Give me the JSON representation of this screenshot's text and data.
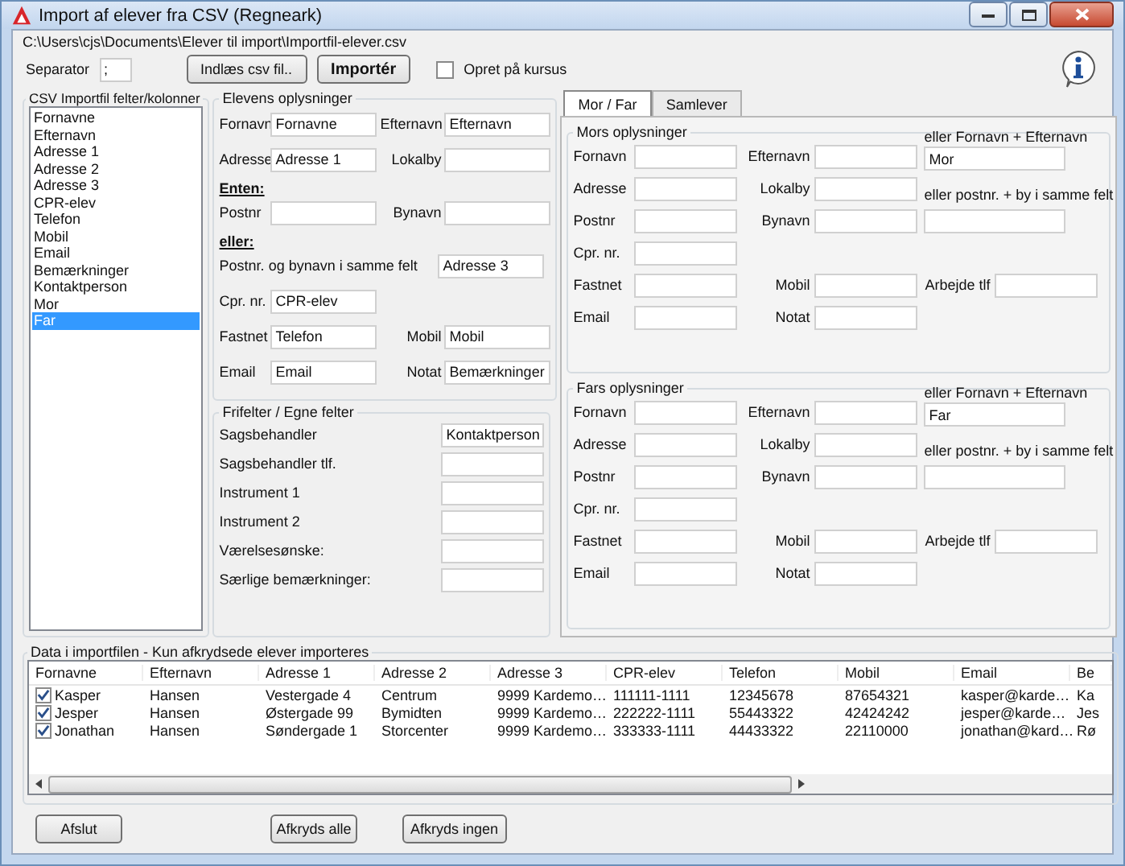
{
  "window": {
    "title": "Import af elever fra CSV (Regneark)"
  },
  "file_path": "C:\\Users\\cjs\\Documents\\Elever til import\\Importfil-elever.csv",
  "toolbar": {
    "separator_label": "Separator",
    "separator_value": ";",
    "load_button": "Indlæs csv fil..",
    "import_button": "Importér",
    "create_on_course": {
      "label": "Opret på kursus",
      "checked": false
    }
  },
  "csv_columns": {
    "title": "CSV Importfil felter/kolonner",
    "items": [
      {
        "label": "Fornavne",
        "selected": false
      },
      {
        "label": "Efternavn",
        "selected": false
      },
      {
        "label": "Adresse 1",
        "selected": false
      },
      {
        "label": "Adresse 2",
        "selected": false
      },
      {
        "label": "Adresse 3",
        "selected": false
      },
      {
        "label": "CPR-elev",
        "selected": false
      },
      {
        "label": "Telefon",
        "selected": false
      },
      {
        "label": "Mobil",
        "selected": false
      },
      {
        "label": "Email",
        "selected": false
      },
      {
        "label": "Bemærkninger",
        "selected": false
      },
      {
        "label": "Kontaktperson",
        "selected": false
      },
      {
        "label": "Mor",
        "selected": false
      },
      {
        "label": "Far",
        "selected": true
      }
    ]
  },
  "student_info": {
    "title": "Elevens oplysninger",
    "rows": [
      {
        "kind": "pair",
        "cells": [
          {
            "label": "Fornavn",
            "value": "Fornavne"
          },
          {
            "label": "Efternavn",
            "value": "Efternavn"
          }
        ]
      },
      {
        "kind": "pair",
        "cells": [
          {
            "label": "Adresse",
            "value": "Adresse 1"
          },
          {
            "label": "Lokalby"
          }
        ]
      },
      {
        "kind": "heading",
        "text": "Enten:"
      },
      {
        "kind": "pair",
        "cells": [
          {
            "label": "Postnr"
          },
          {
            "label": "Bynavn"
          }
        ]
      },
      {
        "kind": "heading",
        "text": "eller:"
      },
      {
        "kind": "wide",
        "label": "Postnr. og bynavn i samme felt",
        "value": "Adresse 3"
      },
      {
        "kind": "pair",
        "cells": [
          {
            "label": "Cpr. nr.",
            "value": "CPR-elev"
          }
        ]
      },
      {
        "kind": "pair",
        "cells": [
          {
            "label": "Fastnet",
            "value": "Telefon"
          },
          {
            "label": "Mobil",
            "value": "Mobil"
          }
        ]
      },
      {
        "kind": "pair",
        "cells": [
          {
            "label": "Email",
            "value": "Email"
          },
          {
            "label": "Notat",
            "value": "Bemærkninger"
          }
        ]
      }
    ]
  },
  "free_fields": {
    "title": "Frifelter / Egne felter",
    "fields": [
      {
        "label": "Sagsbehandler",
        "value": "Kontaktperson"
      },
      {
        "label": "Sagsbehandler tlf."
      },
      {
        "label": "Instrument 1"
      },
      {
        "label": "Instrument 2"
      },
      {
        "label": "Værelsesønske:"
      },
      {
        "label": "Særlige bemærkninger:"
      }
    ]
  },
  "tabs": [
    {
      "label": "Mor / Far",
      "selected": true
    },
    {
      "label": "Samlever",
      "selected": false
    }
  ],
  "parents": [
    {
      "title": "Mors oplysninger",
      "rows": [
        [
          {
            "kind": "field",
            "label": "Fornavn"
          },
          {
            "kind": "field",
            "label": "Efternavn"
          },
          {
            "kind": "stacked",
            "label": "eller Fornavn + Efternavn",
            "value": "Mor"
          }
        ],
        [
          {
            "kind": "field",
            "label": "Adresse"
          },
          {
            "kind": "field",
            "label": "Lokalby"
          },
          {
            "kind": "caption",
            "label": "eller postnr. + by i samme felt"
          }
        ],
        [
          {
            "kind": "field",
            "label": "Postnr"
          },
          {
            "kind": "field",
            "label": "Bynavn"
          },
          {
            "kind": "input"
          }
        ],
        [
          {
            "kind": "field",
            "label": "Cpr. nr."
          }
        ],
        [
          {
            "kind": "field",
            "label": "Fastnet"
          },
          {
            "kind": "field",
            "label": "Mobil"
          },
          {
            "kind": "field",
            "label": "Arbejde tlf"
          }
        ],
        [
          {
            "kind": "field",
            "label": "Email"
          },
          {
            "kind": "field",
            "label": "Notat"
          }
        ]
      ]
    },
    {
      "title": "Fars oplysninger",
      "rows": [
        [
          {
            "kind": "field",
            "label": "Fornavn"
          },
          {
            "kind": "field",
            "label": "Efternavn"
          },
          {
            "kind": "stacked",
            "label": "eller Fornavn + Efternavn",
            "value": "Far"
          }
        ],
        [
          {
            "kind": "field",
            "label": "Adresse"
          },
          {
            "kind": "field",
            "label": "Lokalby"
          },
          {
            "kind": "caption",
            "label": "eller postnr. + by i samme felt"
          }
        ],
        [
          {
            "kind": "field",
            "label": "Postnr"
          },
          {
            "kind": "field",
            "label": "Bynavn"
          },
          {
            "kind": "input"
          }
        ],
        [
          {
            "kind": "field",
            "label": "Cpr. nr."
          }
        ],
        [
          {
            "kind": "field",
            "label": "Fastnet"
          },
          {
            "kind": "field",
            "label": "Mobil"
          },
          {
            "kind": "field",
            "label": "Arbejde tlf"
          }
        ],
        [
          {
            "kind": "field",
            "label": "Email"
          },
          {
            "kind": "field",
            "label": "Notat"
          }
        ]
      ]
    }
  ],
  "table": {
    "title": "Data i importfilen - Kun afkrydsede elever importeres",
    "columns": [
      "Fornavne",
      "Efternavn",
      "Adresse 1",
      "Adresse 2",
      "Adresse 3",
      "CPR-elev",
      "Telefon",
      "Mobil",
      "Email",
      "Be"
    ],
    "rows": [
      {
        "checked": true,
        "cells": [
          "Kasper",
          "Hansen",
          "Vestergade 4",
          "Centrum",
          "9999 Kardemo…",
          "111111-1111",
          "12345678",
          "87654321",
          "kasper@karde…",
          "Ka"
        ]
      },
      {
        "checked": true,
        "cells": [
          "Jesper",
          "Hansen",
          "Østergade 99",
          "Bymidten",
          "9999 Kardemo…",
          "222222-1111",
          "55443322",
          "42424242",
          "jesper@karde…",
          "Jes"
        ]
      },
      {
        "checked": true,
        "cells": [
          "Jonathan",
          "Hansen",
          "Søndergade 1",
          "Storcenter",
          "9999 Kardemo…",
          "333333-1111",
          "44433322",
          "22110000",
          "jonathan@kard…",
          "Rø"
        ]
      }
    ]
  },
  "buttons": [
    "Afslut",
    "Afkryds alle",
    "Afkryds ingen"
  ]
}
